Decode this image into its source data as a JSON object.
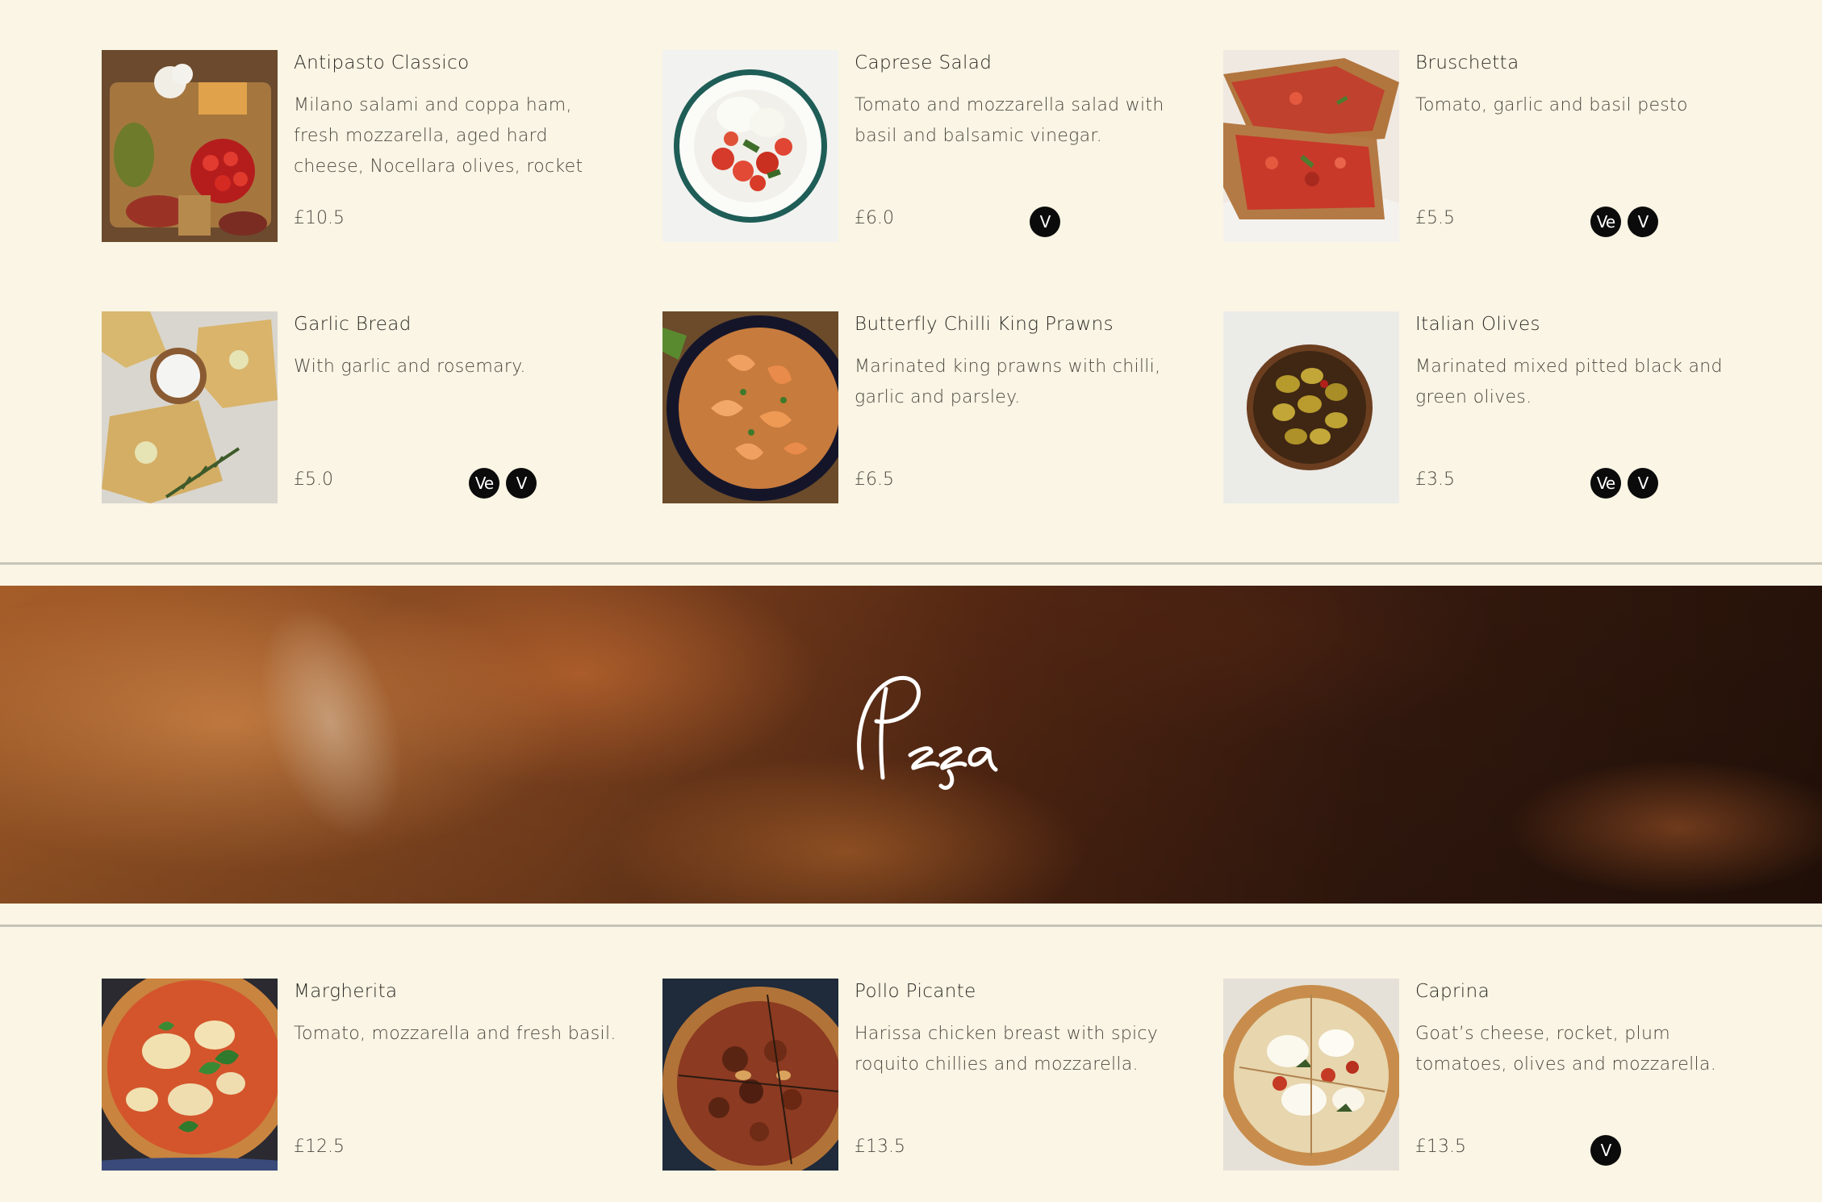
{
  "starters": [
    {
      "name": "Antipasto Classico",
      "desc": "Milano salami and coppa ham, fresh mozzarella, aged hard cheese, Nocellara olives, rocket salad and",
      "price": "£10.5",
      "badges": [],
      "image": "antipasto-platter-photo"
    },
    {
      "name": "Caprese Salad",
      "desc": "Tomato and mozzarella salad with basil and balsamic vinegar.",
      "price": "£6.0",
      "badges": [
        "V"
      ],
      "image": "caprese-salad-photo"
    },
    {
      "name": "Bruschetta",
      "desc": "Tomato, garlic and basil pesto",
      "price": "£5.5",
      "badges": [
        "Ve",
        "V"
      ],
      "image": "bruschetta-photo"
    },
    {
      "name": "Garlic Bread",
      "desc": "With garlic and rosemary.",
      "price": "£5.0",
      "badges": [
        "Ve",
        "V"
      ],
      "image": "garlic-bread-photo"
    },
    {
      "name": "Butterfly Chilli King Prawns",
      "desc": "Marinated king prawns with chilli, garlic and parsley.",
      "price": "£6.5",
      "badges": [],
      "image": "king-prawns-photo"
    },
    {
      "name": "Italian Olives",
      "desc": "Marinated mixed pitted black and green olives.",
      "price": "£3.5",
      "badges": [
        "Ve",
        "V"
      ],
      "image": "olives-bowl-photo"
    }
  ],
  "banner": {
    "title": "Pizza",
    "image": "wood-fired-oven-photo"
  },
  "pizzas": [
    {
      "name": "Margherita",
      "desc": "Tomato, mozzarella and fresh basil.",
      "price": "£12.5",
      "badges": [],
      "image": "margherita-pizza-photo"
    },
    {
      "name": "Pollo Picante",
      "desc": "Harissa chicken breast with spicy roquito chillies and mozzarella.",
      "price": "£13.5",
      "badges": [],
      "image": "pollo-picante-pizza-photo"
    },
    {
      "name": "Caprina",
      "desc": "Goat’s cheese, rocket, plum tomatoes, olives and mozzarella.",
      "price": "£13.5",
      "badges": [
        "V"
      ],
      "image": "caprina-pizza-photo"
    }
  ],
  "colors": {
    "background": "#faf5e4",
    "badge": "#0b0b0b",
    "rule": "#c7c4b8"
  }
}
